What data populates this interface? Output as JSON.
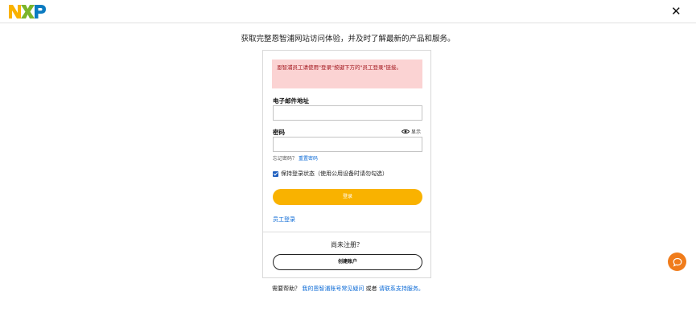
{
  "header": {
    "logo_text": "NXP",
    "close_label": "✕"
  },
  "headline": "获取完整恩智浦网站访问体验，并及时了解最新的产品和服务。",
  "form": {
    "alert": "恩智浦员工请使用\"登录\"按键下方的\"员工登录\"链接。",
    "email_label": "电子邮件地址",
    "email_value": "",
    "password_label": "密码",
    "password_value": "",
    "show_label": "显示",
    "forgot_prefix": "忘记密码？",
    "forgot_link": "重置密码",
    "keep_signed_in": "保持登录状态（使用公用设备时请勿勾选）",
    "keep_signed_in_checked": true,
    "login_button": "登录",
    "employee_login": "员工登录",
    "not_registered": "尚未注册？",
    "create_account_button": "创建账户"
  },
  "help": {
    "prefix": "需要帮助？",
    "faq_link": "我的恩智浦账号常见疑问",
    "or": "或者",
    "support_link": "请联系支持服务。"
  },
  "colors": {
    "accent_yellow": "#f9b200",
    "alert_bg": "#fbd3d3",
    "alert_text": "#a1131a",
    "link_blue": "#0b6ad6",
    "chat_orange": "#f07c1b"
  },
  "icons": {
    "logo": "nxp-logo",
    "close": "close-icon",
    "show_password": "eye-icon",
    "chat": "chat-bubble-icon"
  }
}
